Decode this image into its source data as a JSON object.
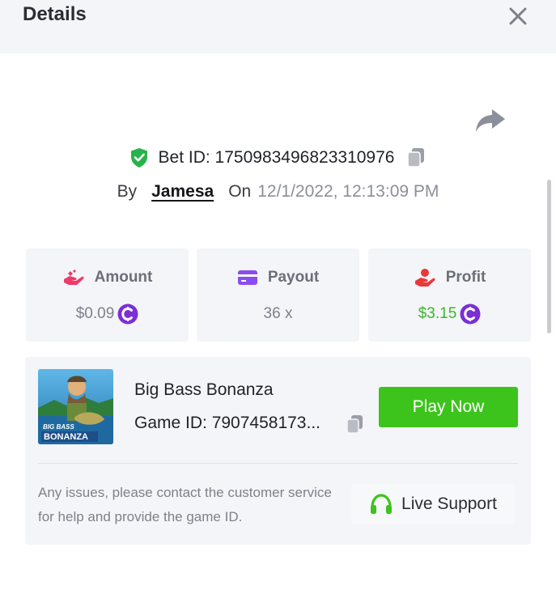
{
  "header": {
    "title": "Details"
  },
  "bet": {
    "id_label": "Bet ID: 1750983496823310976",
    "by_label": "By",
    "user": "Jamesa",
    "on_label": "On",
    "datetime": "12/1/2022, 12:13:09 PM"
  },
  "stats": [
    {
      "label": "Amount",
      "value": "$0.09",
      "icon": "amount-hand-icon",
      "value_color": "#7d818a"
    },
    {
      "label": "Payout",
      "value": "36 x",
      "icon": "card-icon"
    },
    {
      "label": "Profit",
      "value": "$3.15",
      "icon": "profit-hand-icon",
      "value_color": "#3cb52a"
    }
  ],
  "game": {
    "name": "Big Bass Bonanza",
    "id_label": "Game ID: 7907458173...",
    "thumb_text_top": "BIG BASS",
    "thumb_text_bottom": "BONANZA",
    "play_label": "Play Now"
  },
  "support": {
    "text": "Any issues, please contact the customer service for help and provide the game ID.",
    "button_label": "Live Support"
  },
  "colors": {
    "accent_green": "#3cc41c",
    "coin_purple": "#7b2fd6",
    "shield_green": "#27b34a",
    "amount_pink": "#ee3a6a",
    "payout_purple": "#8a4df0",
    "profit_red": "#e8383b"
  }
}
